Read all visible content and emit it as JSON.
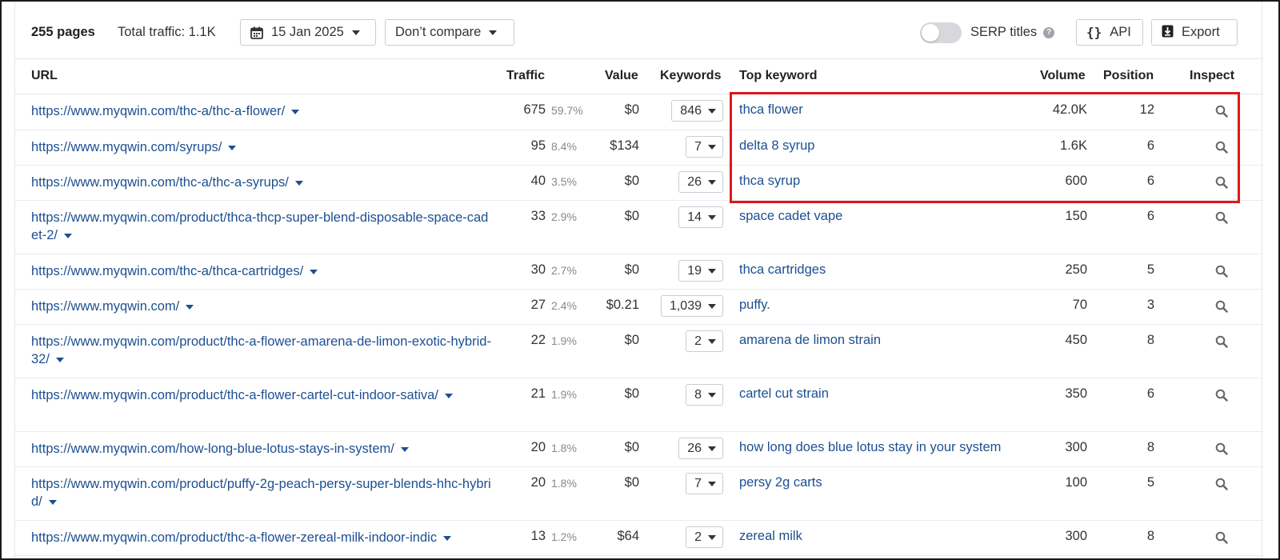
{
  "toolbar": {
    "pages_count": "255 pages",
    "total_traffic": "Total traffic: 1.1K",
    "date": "15 Jan 2025",
    "compare": "Don’t compare",
    "serp_titles": "SERP titles",
    "help": "?",
    "api": "API",
    "export": "Export"
  },
  "columns": {
    "url": "URL",
    "traffic": "Traffic",
    "value": "Value",
    "keywords": "Keywords",
    "top_keyword": "Top keyword",
    "volume": "Volume",
    "position": "Position",
    "inspect": "Inspect"
  },
  "rows": [
    {
      "url": "https://www.myqwin.com/thc-a/thc-a-flower/",
      "traffic": "675",
      "pct": "59.7%",
      "value": "$0",
      "keywords": "846",
      "top_keyword": "thca flower",
      "volume": "42.0K",
      "position": "12"
    },
    {
      "url": "https://www.myqwin.com/syrups/",
      "traffic": "95",
      "pct": "8.4%",
      "value": "$134",
      "keywords": "7",
      "top_keyword": "delta 8 syrup",
      "volume": "1.6K",
      "position": "6"
    },
    {
      "url": "https://www.myqwin.com/thc-a/thc-a-syrups/",
      "traffic": "40",
      "pct": "3.5%",
      "value": "$0",
      "keywords": "26",
      "top_keyword": "thca syrup",
      "volume": "600",
      "position": "6"
    },
    {
      "url": "https://www.myqwin.com/product/thca-thcp-super-blend-disposable-space-cadet-2/",
      "traffic": "33",
      "pct": "2.9%",
      "value": "$0",
      "keywords": "14",
      "top_keyword": "space cadet vape",
      "volume": "150",
      "position": "6"
    },
    {
      "url": "https://www.myqwin.com/thc-a/thca-cartridges/",
      "traffic": "30",
      "pct": "2.7%",
      "value": "$0",
      "keywords": "19",
      "top_keyword": "thca cartridges",
      "volume": "250",
      "position": "5"
    },
    {
      "url": "https://www.myqwin.com/",
      "traffic": "27",
      "pct": "2.4%",
      "value": "$0.21",
      "keywords": "1,039",
      "top_keyword": "puffy.",
      "volume": "70",
      "position": "3"
    },
    {
      "url": "https://www.myqwin.com/product/thc-a-flower-amarena-de-limon-exotic-hybrid-32/",
      "traffic": "22",
      "pct": "1.9%",
      "value": "$0",
      "keywords": "2",
      "top_keyword": "amarena de limon strain",
      "volume": "450",
      "position": "8"
    },
    {
      "url": "https://www.myqwin.com/product/thc-a-flower-cartel-cut-indoor-sativa/",
      "traffic": "21",
      "pct": "1.9%",
      "value": "$0",
      "keywords": "8",
      "top_keyword": "cartel cut strain",
      "volume": "350",
      "position": "6"
    },
    {
      "url": "https://www.myqwin.com/how-long-blue-lotus-stays-in-system/",
      "traffic": "20",
      "pct": "1.8%",
      "value": "$0",
      "keywords": "26",
      "top_keyword": "how long does blue lotus stay in your system",
      "volume": "300",
      "position": "8"
    },
    {
      "url": "https://www.myqwin.com/product/puffy-2g-peach-persy-super-blends-hhc-hybrid/",
      "traffic": "20",
      "pct": "1.8%",
      "value": "$0",
      "keywords": "7",
      "top_keyword": "persy 2g carts",
      "volume": "100",
      "position": "5"
    },
    {
      "url": "https://www.myqwin.com/product/thc-a-flower-zereal-milk-indoor-indic",
      "traffic": "13",
      "pct": "1.2%",
      "value": "$64",
      "keywords": "2",
      "top_keyword": "zereal milk",
      "volume": "300",
      "position": "8"
    }
  ],
  "colors": {
    "link": "#1d4f91",
    "highlight_box": "#e0161b",
    "border": "#e4e6ea"
  }
}
